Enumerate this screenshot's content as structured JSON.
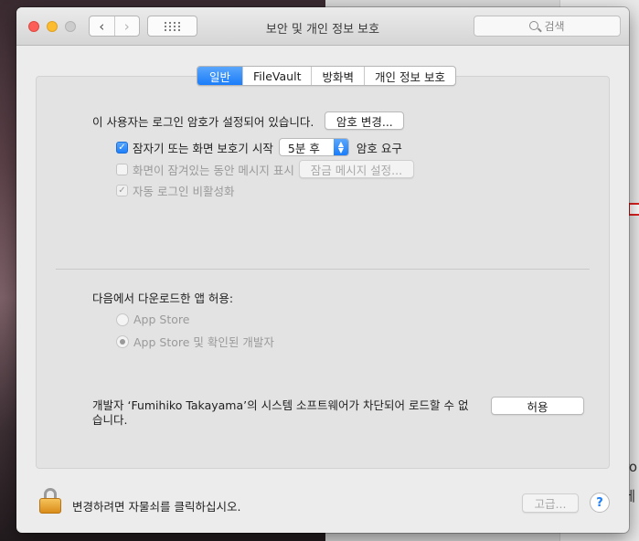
{
  "window": {
    "title": "보안 및 개인 정보 보호",
    "search_placeholder": "검색",
    "nav_back": "‹",
    "nav_forward": "›"
  },
  "tabs": [
    {
      "label": "일반",
      "active": true
    },
    {
      "label": "FileVault",
      "active": false
    },
    {
      "label": "방화벽",
      "active": false
    },
    {
      "label": "개인 정보 보호",
      "active": false
    }
  ],
  "general": {
    "password_text": "이 사용자는 로그인 암호가 설정되어 있습니다.",
    "change_password_label": "암호 변경...",
    "require_password_label": "잠자기 또는 화면 보호기 시작",
    "require_password_checked": true,
    "delay_value": "5분 후",
    "require_password_suffix": "암호 요구",
    "show_message_label": "화면이 잠겨있는 동안 메시지 표시",
    "show_message_checked": false,
    "set_lock_message_label": "잠금 메시지 설정...",
    "disable_autologin_label": "자동 로그인 비활성화",
    "disable_autologin_checked": true
  },
  "downloads": {
    "heading": "다음에서 다운로드한 앱 허용:",
    "options": [
      {
        "label": "App Store",
        "selected": false
      },
      {
        "label": "App Store 및 확인된 개발자",
        "selected": true
      }
    ]
  },
  "blocked": {
    "message_line1": "개발자 ‘Fumihiko Takayama’의 시스템 소프트웨어가 차단되어 로드할 수 없",
    "message_line2": "습니다.",
    "allow_label": "허용"
  },
  "footer": {
    "lock_text": "변경하려면 자물쇠를 클릭하십시오.",
    "advanced_label": "고급...",
    "help_label": "?"
  },
  "background": {
    "right_text1": "ro",
    "right_text2": "에"
  }
}
